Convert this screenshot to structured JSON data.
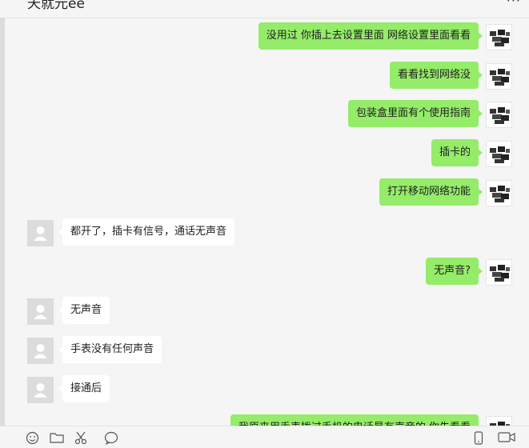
{
  "header": {
    "title": "天就元ee",
    "more_icon": "more-icon"
  },
  "messages": [
    {
      "side": "me",
      "text": "没用过 你插上去设置里面 网络设置里面看看"
    },
    {
      "side": "me",
      "text": "看看找到网络没"
    },
    {
      "side": "me",
      "text": "包装盒里面有个使用指南"
    },
    {
      "side": "me",
      "text": "插卡的"
    },
    {
      "side": "me",
      "text": "打开移动网络功能"
    },
    {
      "side": "them",
      "text": "都开了，插卡有信号，通话无声音"
    },
    {
      "side": "me",
      "text": "无声音?"
    },
    {
      "side": "them",
      "text": "无声音"
    },
    {
      "side": "them",
      "text": "手表没有任何声音"
    },
    {
      "side": "them",
      "text": "接通后"
    },
    {
      "side": "me",
      "text": "我原来用手表拨过手机的电话是有声音的 你先看看"
    }
  ],
  "toolbar": {
    "icons": [
      "emoji-icon",
      "folder-icon",
      "scissors-icon",
      "chat-history-icon",
      "phone-icon",
      "video-call-icon"
    ]
  },
  "colors": {
    "my_bubble": "#95ec69",
    "their_bubble": "#ffffff",
    "background": "#f5f5f5"
  }
}
